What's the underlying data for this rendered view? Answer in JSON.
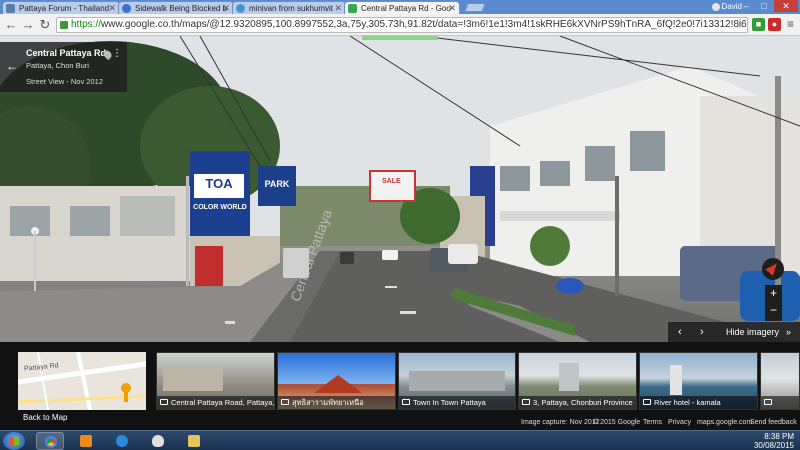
{
  "browser": {
    "tabs": [
      {
        "label": "Pattaya Forum - Thailand",
        "favicon_color": "#5a7ca8",
        "active": false
      },
      {
        "label": "Sidewalk Being Blocked b",
        "favicon_color": "#3b6fd0",
        "active": false
      },
      {
        "label": "minivan from sukhumvit",
        "favicon_color": "#4a90d9",
        "active": false
      },
      {
        "label": "Central Pattaya Rd - Goo",
        "favicon_color": "#35a853",
        "active": true
      }
    ],
    "user_name": "David",
    "window_controls": {
      "minimize": "–",
      "maximize": "□",
      "close": "✕"
    },
    "back_glyph": "←",
    "forward_glyph": "→",
    "reload_glyph": "↻",
    "url_scheme": "https://",
    "url_rest": "www.google.co.th/maps/@12.9320895,100.8997552,3a,75y,305.73h,91.82t/data=!3m6!1e1!3m4!1skRHE6kXVNrPS9hTnRA_6fQ!2e0!7i13312!8i6656?hl=e",
    "star_glyph": "☆",
    "extensions": [
      {
        "name": "puzzle-extension-icon",
        "color": "#2f9d3a",
        "glyph": "■"
      },
      {
        "name": "lastpass-extension-icon",
        "color": "#cc2a2a",
        "glyph": "●"
      },
      {
        "name": "menu-icon",
        "color": "#777777",
        "glyph": "≡"
      }
    ]
  },
  "streetview": {
    "place_title": "Central Pattaya Rd",
    "place_sub": "Pattaya, Chon Buri",
    "capture_label": "Street View - Nov 2012",
    "back_glyph": "←",
    "more_glyph": "⋮",
    "signs": {
      "toa": "TOA",
      "color_world": "COLOR WORLD",
      "park": "PARK",
      "sale": "SALE"
    },
    "road_text": "Central Pattaya",
    "zoom_in": "+",
    "zoom_out": "−",
    "hide_imagery": "Hide imagery",
    "hide_prev": "‹",
    "hide_next": "›",
    "hide_chevron": "»"
  },
  "filmstrip": {
    "minimap_road_label": "Pattaya Rd",
    "back_to_map": "Back to Map",
    "thumbs": [
      {
        "caption": "Central Pattaya Road, Pattaya, C..."
      },
      {
        "caption": "สุทธิสารามพัทยาเหนือ"
      },
      {
        "caption": "Town In Town Pattaya"
      },
      {
        "caption": "3, Pattaya, Chonburi Province"
      },
      {
        "caption": "River hotel - kamala"
      },
      {
        "caption": ""
      }
    ],
    "footer": {
      "capture": "Image capture: Nov 2012",
      "copyright": "© 2015 Google",
      "terms": "Terms",
      "privacy": "Privacy",
      "domain": "maps.google.com",
      "feedback": "Send feedback"
    }
  },
  "taskbar": {
    "time": "8:38 PM",
    "date": "30/08/2015",
    "apps": [
      {
        "name": "chrome-taskbar-icon",
        "color": "#e8b81a",
        "active": true
      },
      {
        "name": "media-player-taskbar-icon",
        "color": "#f08a1c",
        "active": false
      },
      {
        "name": "internet-explorer-taskbar-icon",
        "color": "#2a8ad8",
        "active": false
      },
      {
        "name": "flame-app-taskbar-icon",
        "color": "#e0e0e0",
        "active": false
      },
      {
        "name": "file-explorer-taskbar-icon",
        "color": "#e8c35a",
        "active": false
      }
    ]
  }
}
